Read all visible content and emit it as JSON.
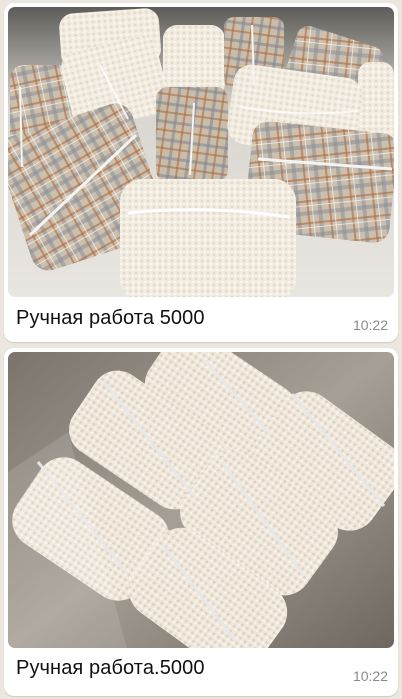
{
  "messages": [
    {
      "caption": "Ручная работа 5000",
      "time": "10:22",
      "photo": "plaid-and-terry-cosmetic-bags"
    },
    {
      "caption": "Ручная работа.5000",
      "time": "10:22",
      "photo": "cream-terry-cosmetic-bags"
    }
  ],
  "colors": {
    "bubble": "#ffffff",
    "chat_background": "#ebe6de",
    "caption_text": "#111111",
    "time_text": "#8a8a8a",
    "plaid_base": "#cbbfae",
    "terry_cream": "#f1ebe0"
  }
}
